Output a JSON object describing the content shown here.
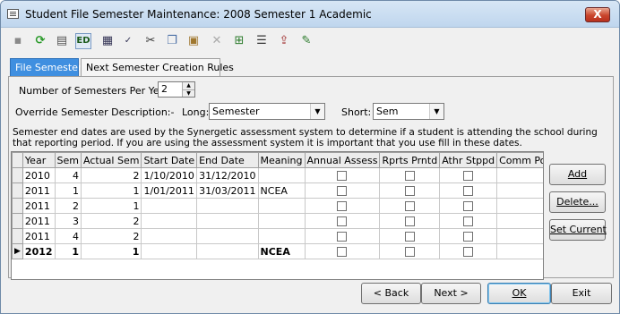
{
  "window": {
    "title": "Student File Semester Maintenance:  2008 Semester 1 Academic",
    "close_label": "X"
  },
  "toolbar": {
    "icons": [
      "save-icon",
      "refresh-icon",
      "print-icon",
      "edit-mode-icon",
      "calculator-icon",
      "spell-check-icon",
      "cut-icon",
      "copy-icon",
      "paste-icon",
      "delete-icon",
      "find-icon",
      "list-icon",
      "export-icon",
      "notes-icon"
    ],
    "ed_label": "ED"
  },
  "tabs": [
    {
      "label": "File Semester"
    },
    {
      "label": "Next Semester Creation Rules"
    }
  ],
  "form": {
    "semesters_label": "Number of Semesters Per Year:",
    "semesters_value": "2",
    "override_label": "Override Semester Description:-",
    "long_label": "Long:",
    "long_value": "Semester",
    "short_label": "Short:",
    "short_value": "Sem",
    "note": "Semester end dates are used by the Synergetic assessment system to determine if a student is attending the school during that reporting period.  If you are using the assessment system it is important that you use fill in these dates."
  },
  "grid": {
    "columns": [
      "Year",
      "Sem",
      "Actual Sem",
      "Start Date",
      "End Date",
      "Meaning",
      "Annual Assess",
      "Rprts Prntd",
      "Athr Stppd",
      "Comm Portal Current"
    ],
    "rows": [
      {
        "year": "2010",
        "sem": "4",
        "actual": "2",
        "start": "1/10/2010",
        "end": "31/12/2010",
        "meaning": "",
        "annual": false,
        "prntd": false,
        "stppd": false,
        "portal": false
      },
      {
        "year": "2011",
        "sem": "1",
        "actual": "1",
        "start": "1/01/2011",
        "end": "31/03/2011",
        "meaning": "NCEA",
        "annual": false,
        "prntd": false,
        "stppd": false,
        "portal": false
      },
      {
        "year": "2011",
        "sem": "2",
        "actual": "1",
        "start": "",
        "end": "",
        "meaning": "",
        "annual": false,
        "prntd": false,
        "stppd": false,
        "portal": false
      },
      {
        "year": "2011",
        "sem": "3",
        "actual": "2",
        "start": "",
        "end": "",
        "meaning": "",
        "annual": false,
        "prntd": false,
        "stppd": false,
        "portal": false
      },
      {
        "year": "2011",
        "sem": "4",
        "actual": "2",
        "start": "",
        "end": "",
        "meaning": "",
        "annual": false,
        "prntd": false,
        "stppd": false,
        "portal": false
      },
      {
        "year": "2012",
        "sem": "1",
        "actual": "1",
        "start": "",
        "end": "",
        "meaning": "NCEA",
        "annual": false,
        "prntd": false,
        "stppd": false,
        "portal": true
      }
    ],
    "current_row_indicator": "▶"
  },
  "side_buttons": {
    "add": "Add",
    "delete": "Delete...",
    "set_current": "Set Current"
  },
  "footer_buttons": {
    "back": "< Back",
    "next": "Next >",
    "ok": "OK",
    "exit": "Exit"
  }
}
